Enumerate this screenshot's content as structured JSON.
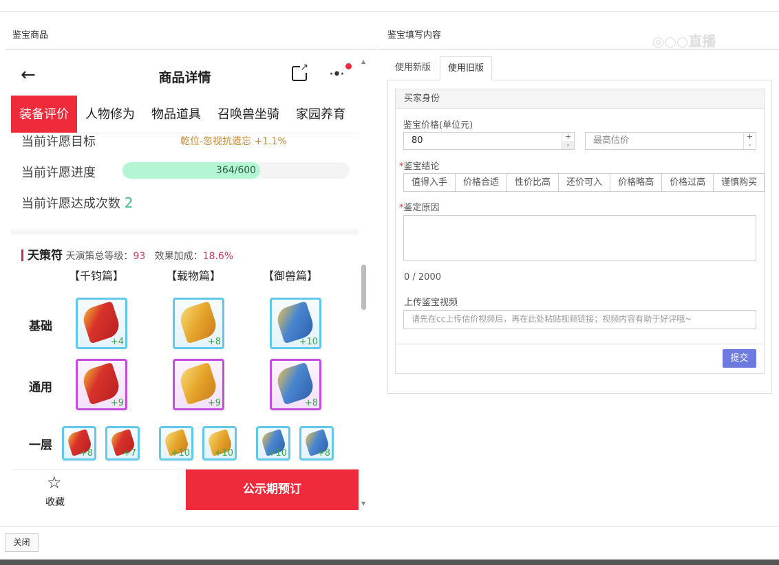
{
  "left_panel": {
    "title": "鉴宝商品"
  },
  "right_panel": {
    "title": "鉴宝填写内容",
    "watermark": "CC直播"
  },
  "phone": {
    "title": "商品详情",
    "tabs": [
      "装备评价",
      "人物修为",
      "物品道具",
      "召唤兽坐骑",
      "家园养育"
    ],
    "wish_target_label": "当前许愿目标",
    "wish_target_value": "乾位-忽视抗遗忘 +1.1%",
    "wish_progress_label": "当前许愿进度",
    "wish_progress_text": "364/600",
    "wish_progress_fraction": 0.607,
    "wish_count_label": "当前许愿达成次数",
    "wish_count": "2",
    "section_title": "天策符",
    "total_level_label": "天演策总等级：",
    "total_level": "93",
    "bonus_label": "效果加成：",
    "bonus": "18.6%",
    "columns": [
      "【千钧篇】",
      "【载物篇】",
      "【御兽篇】"
    ],
    "rows": [
      {
        "label": "基础",
        "size": "big",
        "frame": "cyan",
        "items": [
          {
            "color": "red",
            "level": "+4"
          },
          {
            "color": "gold",
            "level": "+8"
          },
          {
            "color": "blue",
            "level": "+10"
          }
        ]
      },
      {
        "label": "通用",
        "size": "big",
        "frame": "purple",
        "items": [
          {
            "color": "red",
            "level": "+9"
          },
          {
            "color": "gold",
            "level": "+9"
          },
          {
            "color": "blue",
            "level": "+8"
          }
        ]
      },
      {
        "label": "一层",
        "size": "small",
        "frame": "cyan",
        "items": [
          {
            "color": "red",
            "level": "+8"
          },
          {
            "color": "red",
            "level": "+7"
          },
          {
            "color": "gold",
            "level": "+10"
          },
          {
            "color": "gold",
            "level": "+10"
          },
          {
            "color": "blue",
            "level": "+10"
          },
          {
            "color": "blue",
            "level": "+8"
          }
        ]
      }
    ],
    "favorite_label": "收藏",
    "buy_label": "公示期预订"
  },
  "form": {
    "tabs": [
      "使用新版",
      "使用旧版"
    ],
    "active_tab": 1,
    "section": "买家身份",
    "price_label": "鉴宝价格(单位元)",
    "price_value": "80",
    "max_price_placeholder": "最高估价",
    "conclusion_label": "鉴宝结论",
    "conclusions": [
      "值得入手",
      "价格合适",
      "性价比高",
      "还价可入",
      "价格略高",
      "价格过高",
      "谨慎购买"
    ],
    "reason_label": "鉴定原因",
    "reason_count": "0 / 2000",
    "video_label": "上传鉴宝视频",
    "video_placeholder": "请先在cc上传估价视频后，再在此处粘贴视频链接；视频内容有助于好评哦~",
    "submit": "提交"
  },
  "footer": {
    "close": "关闭"
  },
  "colors": {
    "accent": "#ee2a3b",
    "submit": "#6d7ae0",
    "red": "#d8322a",
    "gold": "#e6a52a",
    "blue": "#4a86d0"
  }
}
